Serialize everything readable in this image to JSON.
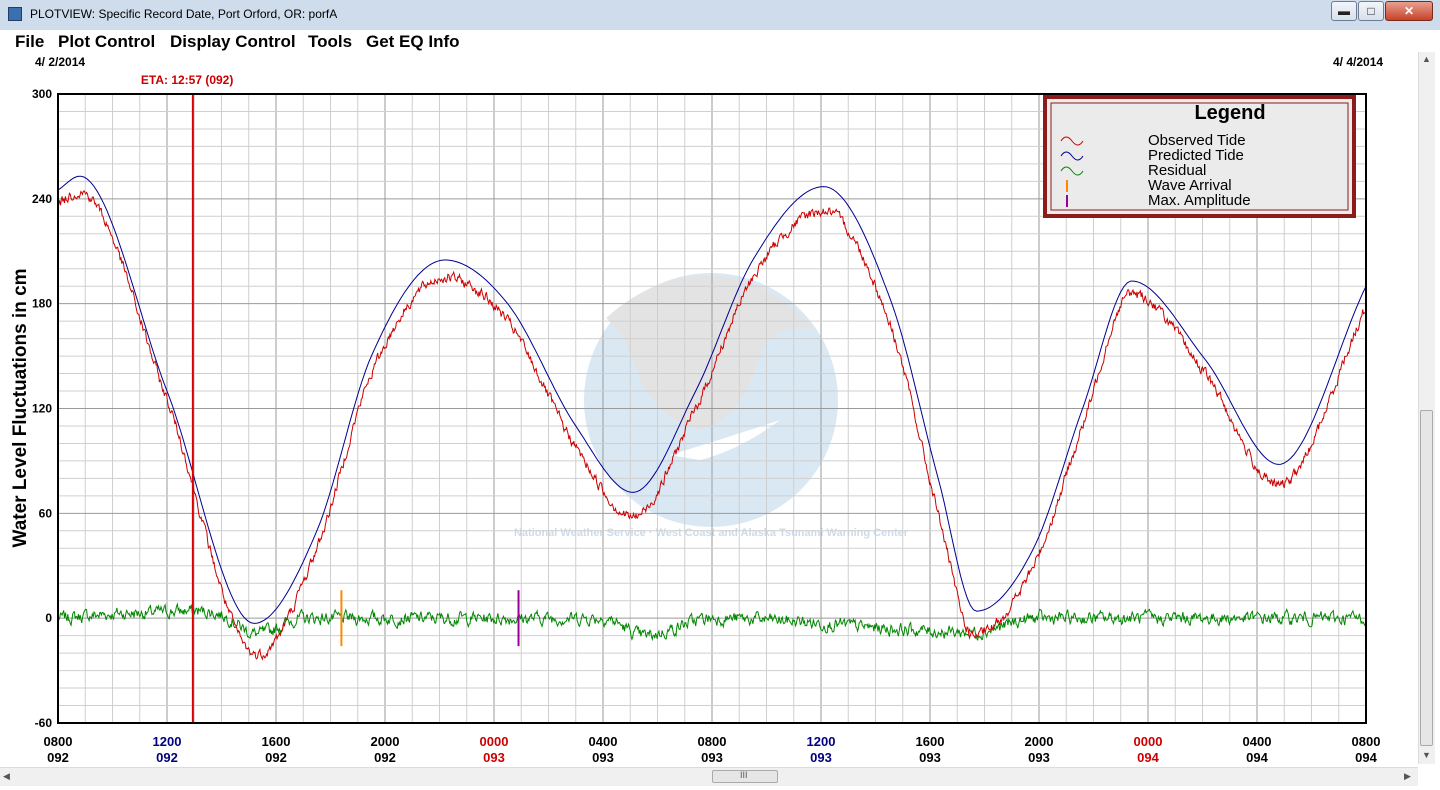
{
  "window": {
    "title": "PLOTVIEW: Specific Record Date, Port Orford, OR: porfA",
    "minimize_label": "▬",
    "maximize_label": "□",
    "close_label": "✕"
  },
  "menu": [
    "File",
    "Plot Control",
    "Display Control",
    "Tools",
    "Get EQ Info"
  ],
  "scrollbars": {
    "up_arrow": "▲",
    "down_arrow": "▼",
    "left_arrow": "◀",
    "right_arrow": "▶",
    "grip": "III"
  },
  "chart_data": {
    "type": "line",
    "ylabel": "Water Level Fluctuations in cm",
    "start_date_label": "4/ 2/2014",
    "end_date_label": "4/ 4/2014",
    "eta_label": "ETA: 12:57 (092)",
    "eta_hours_after_start": 4.95,
    "ylim": [
      -60,
      300
    ],
    "yticks": [
      -60,
      0,
      60,
      120,
      180,
      240,
      300
    ],
    "x_range_hours": [
      0,
      48
    ],
    "x_ticks": [
      {
        "time": "0800",
        "day": "092",
        "color": "#000000"
      },
      {
        "time": "1200",
        "day": "092",
        "color": "#000080"
      },
      {
        "time": "1600",
        "day": "092",
        "color": "#000000"
      },
      {
        "time": "2000",
        "day": "092",
        "color": "#000000"
      },
      {
        "time": "0000",
        "day": "093",
        "color": "#cc0000"
      },
      {
        "time": "0400",
        "day": "093",
        "color": "#000000"
      },
      {
        "time": "0800",
        "day": "093",
        "color": "#000000"
      },
      {
        "time": "1200",
        "day": "093",
        "color": "#000080"
      },
      {
        "time": "1600",
        "day": "093",
        "color": "#000000"
      },
      {
        "time": "2000",
        "day": "093",
        "color": "#000000"
      },
      {
        "time": "0000",
        "day": "094",
        "color": "#cc0000"
      },
      {
        "time": "0400",
        "day": "094",
        "color": "#000000"
      },
      {
        "time": "0800",
        "day": "094",
        "color": "#000000"
      }
    ],
    "series": [
      {
        "name": "Predicted Tide",
        "color": "#000090",
        "x": [
          0,
          0.8,
          4.0,
          7.2,
          9.5,
          11.5,
          14.2,
          16.5,
          19.0,
          21.1,
          23.4,
          25.5,
          28.1,
          30.6,
          32.3,
          33.7,
          35.8,
          37.6,
          39.4,
          42.1,
          44.8,
          48.0
        ],
        "y": [
          245,
          253,
          130,
          -3,
          50,
          150,
          205,
          180,
          110,
          72,
          130,
          205,
          247,
          180,
          80,
          4,
          40,
          120,
          193,
          148,
          88,
          190
        ]
      },
      {
        "name": "Observed Tide",
        "color": "#cc0000",
        "x": [
          0,
          0.8,
          4.0,
          7.3,
          9.5,
          11.5,
          14.2,
          16.5,
          19.0,
          21.1,
          23.4,
          25.5,
          28.1,
          30.6,
          32.3,
          33.6,
          35.8,
          37.6,
          39.4,
          42.1,
          44.8,
          48.0
        ],
        "y": [
          237,
          244,
          125,
          -21,
          40,
          140,
          195,
          170,
          98,
          58,
          120,
          195,
          233,
          165,
          60,
          -10,
          30,
          110,
          186,
          140,
          76,
          178
        ]
      },
      {
        "name": "Residual",
        "color": "#008800",
        "x": [
          0,
          3.0,
          6.0,
          7.3,
          9.0,
          12.0,
          19.5,
          20.0,
          21.5,
          24.0,
          33.6,
          36.0,
          48.0
        ],
        "y": [
          0,
          3,
          2,
          -9,
          0,
          0,
          0,
          0,
          -10,
          0,
          -8,
          0,
          0
        ]
      }
    ],
    "markers": [
      {
        "name": "Wave Arrival",
        "hours_after_start": 10.4,
        "color": "#ff8800"
      },
      {
        "name": "Max. Amplitude",
        "hours_after_start": 16.9,
        "color": "#990099"
      }
    ],
    "legend": {
      "title": "Legend",
      "position": "top-right",
      "entries": [
        {
          "label": "Observed Tide",
          "color": "#cc0000",
          "kind": "wave"
        },
        {
          "label": "Predicted Tide",
          "color": "#000090",
          "kind": "wave"
        },
        {
          "label": "Residual",
          "color": "#008800",
          "kind": "wave"
        },
        {
          "label": "Wave Arrival",
          "color": "#ff8800",
          "kind": "bar"
        },
        {
          "label": "Max. Amplitude",
          "color": "#990099",
          "kind": "bar"
        }
      ]
    },
    "watermark_text": "National Weather Service · West Coast and Alaska Tsunami Warning Center",
    "grid": true
  }
}
